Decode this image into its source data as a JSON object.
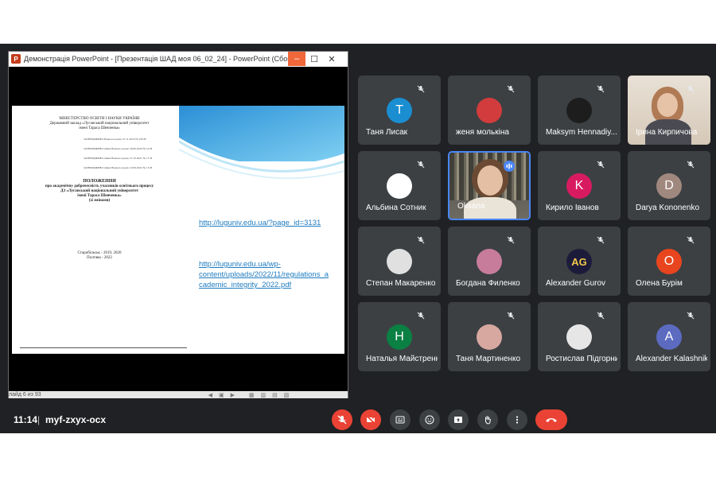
{
  "presentation": {
    "window_title": "Демонстрація PowerPoint - [Презентація ШАД моя 06_02_24] - PowerPoint (Сбой ак...",
    "logo_text": "P",
    "slide": {
      "ministry": "МІНІСТЕРСТВО ОСВІТИ І НАУКИ УКРАЇНИ",
      "institution_line1": "Державний заклад «Луганський національний університет",
      "institution_line2": "імені Тараса Шевченка»",
      "approval_blocks": [
        "ЗАТВЕРДЖЕНО Вченою радою 27.11.2019 № 250-Н",
        "ЗАТВЕРДЖЕНО зміни Вченою радою 26.06.2020 № 10-Н",
        "ЗАТВЕРДЖЕНО зміни Вченою радою 27.10.2021 № 17-Н",
        "ЗАТВЕРДЖЕНО зміни Вченою радою 10.09.2022 № 13-Н"
      ],
      "doc_title": "ПОЛОЖЕННЯ",
      "doc_subtitle1": "про академічну доброчесність учасників освітнього процесу",
      "doc_subtitle2": "ДЗ «Луганський національний університет",
      "doc_subtitle3": "імені Тараса Шевченка»",
      "doc_subtitle4": "(зі змінами)",
      "footer_city": "Старобільськ - 2019, 2020",
      "footer_city2": "Полтава - 2022",
      "link1": "http://luguniv.edu.ua/?page_id=3131",
      "link2_line1": "http://luguniv.edu.ua/wp-",
      "link2_line2": "content/uploads/2022/11/regulations_a",
      "link2_line3": "cademic_integrity_2022.pdf"
    },
    "status_text": "лайд 6 из 93"
  },
  "participants": [
    {
      "name": "Таня Лисак",
      "initial": "T",
      "color": "#1a8ed1"
    },
    {
      "name": "женя молькіна",
      "initial": "",
      "color": "#d23c3c"
    },
    {
      "name": "Maksym Hennadiy...",
      "initial": "",
      "color": "#1d1d1d"
    },
    {
      "name": "Ірина Кирпичова",
      "initial": "",
      "color": "#cfc3b5"
    },
    {
      "name": "Альбина Сотник",
      "initial": "",
      "color": "#ffffff"
    },
    {
      "name": "Oksana",
      "initial": "",
      "color": "#6b7280"
    },
    {
      "name": "Кирило Іванов",
      "initial": "K",
      "color": "#d81b60"
    },
    {
      "name": "Darya Kononenko",
      "initial": "D",
      "color": "#a1887f"
    },
    {
      "name": "Степан Макаренко",
      "initial": "",
      "color": "#e0e0e0"
    },
    {
      "name": "Богдана Филенко",
      "initial": "",
      "color": "#c77c9b"
    },
    {
      "name": "Alexander Gurov",
      "initial": "AG",
      "color": "#1c1c3a"
    },
    {
      "name": "Олена Бурім",
      "initial": "O",
      "color": "#e8451e"
    },
    {
      "name": "Наталья Майстренко",
      "initial": "H",
      "color": "#0b8043"
    },
    {
      "name": "Таня Мартиненко",
      "initial": "",
      "color": "#d7a8a0"
    },
    {
      "name": "Ростислав Підгорний",
      "initial": "",
      "color": "#e6e6e6"
    },
    {
      "name": "Alexander Kalashnikov",
      "initial": "A",
      "color": "#5c6bc0"
    }
  ],
  "meeting": {
    "time": "11:14",
    "separator": "|",
    "code": "myf-zxyx-ocx"
  }
}
